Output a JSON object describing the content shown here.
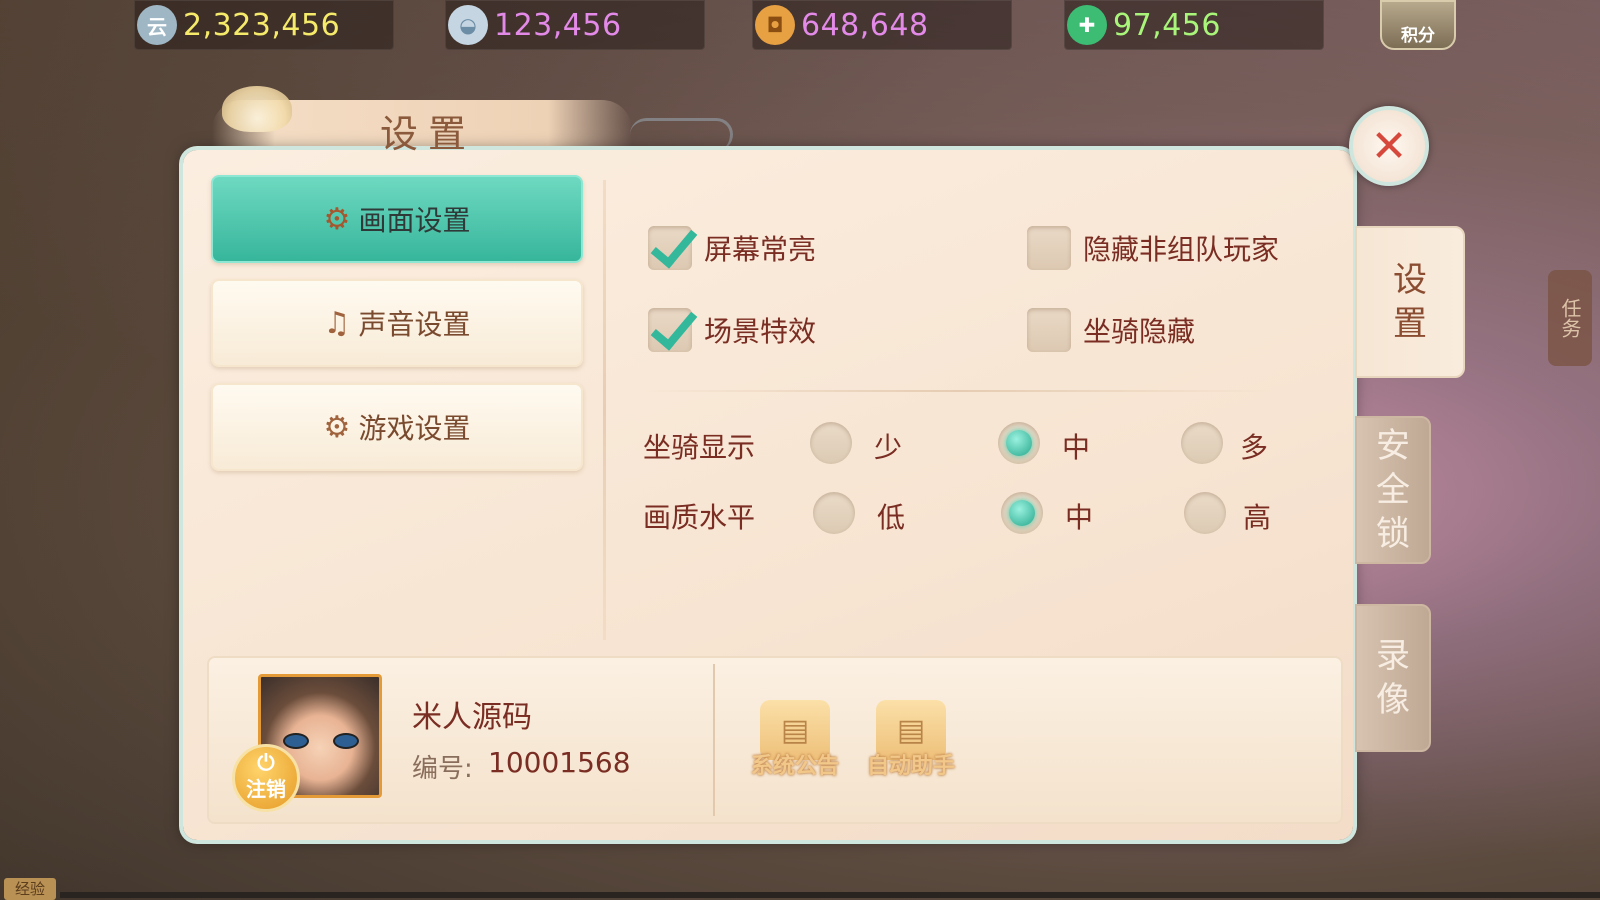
{
  "currencies": [
    {
      "icon": "yun-coin-icon",
      "icon_glyph": "云",
      "value": "2,323,456",
      "color": "#f6ea6a",
      "icon_color": "#9fb7c4"
    },
    {
      "icon": "silver-ingot-icon",
      "icon_glyph": "◒",
      "value": "123,456",
      "color": "#e38ae8",
      "icon_color": "#c5d6e2"
    },
    {
      "icon": "copper-coin-icon",
      "icon_glyph": "◘",
      "value": "648,648",
      "color": "#e38ae8",
      "icon_color": "#e7a042"
    },
    {
      "icon": "jade-add-icon",
      "icon_glyph": "✚",
      "value": "97,456",
      "color": "#a8f57a",
      "icon_color": "#3dbd74"
    }
  ],
  "jifen_label": "积分",
  "panel_title": "设置",
  "menu": [
    {
      "label": "画面设置",
      "icon": "gear-picture-icon",
      "glyph": "⚙",
      "active": true
    },
    {
      "label": "声音设置",
      "icon": "music-note-icon",
      "glyph": "♫",
      "active": false
    },
    {
      "label": "游戏设置",
      "icon": "gears-icon",
      "glyph": "⚙",
      "active": false
    }
  ],
  "checkboxes": [
    {
      "label": "屏幕常亮",
      "checked": true
    },
    {
      "label": "隐藏非组队玩家",
      "checked": false
    },
    {
      "label": "场景特效",
      "checked": true
    },
    {
      "label": "坐骑隐藏",
      "checked": false
    }
  ],
  "mount_display": {
    "label": "坐骑显示",
    "options": [
      "少",
      "中",
      "多"
    ],
    "selected": "中"
  },
  "quality": {
    "label": "画质水平",
    "options": [
      "低",
      "中",
      "高"
    ],
    "selected": "中"
  },
  "player": {
    "name": "米人源码",
    "id_label": "编号:",
    "id": "10001568",
    "logout": "注销"
  },
  "tools": [
    {
      "label": "系统公告",
      "icon": "scroll-icon"
    },
    {
      "label": "自动助手",
      "icon": "scroll-icon"
    }
  ],
  "right_tabs": [
    {
      "label": "设\n置",
      "active": true
    },
    {
      "label": "安\n全\n锁",
      "active": false
    },
    {
      "label": "录\n像",
      "active": false
    }
  ],
  "task_tab": "任务",
  "exp_label": "经验"
}
